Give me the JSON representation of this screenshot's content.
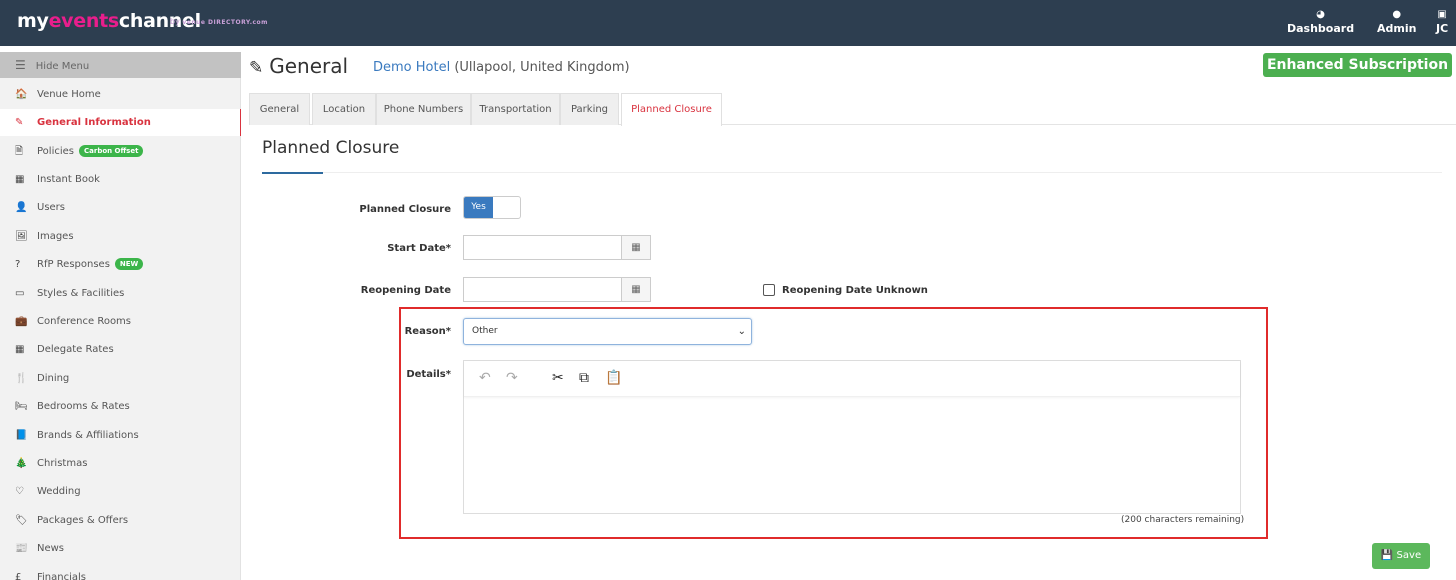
{
  "brand": {
    "part1": "my",
    "part2": "events",
    "part3": "channel",
    "by": "by",
    "by_brand": "venue DIRECTORY.com"
  },
  "topnav": [
    {
      "label": "Dashboard",
      "icon": "dashboard-icon"
    },
    {
      "label": "Admin",
      "icon": "user-circle-icon"
    },
    {
      "label": "JC",
      "icon": "id-badge-icon"
    }
  ],
  "sidebar": {
    "hide_menu": "Hide Menu",
    "items": [
      {
        "label": "Venue Home",
        "icon": "home-icon",
        "glyph": "🏠"
      },
      {
        "label": "General Information",
        "icon": "edit-icon",
        "glyph": "✎",
        "active": true
      },
      {
        "label": "Policies",
        "icon": "document-icon",
        "glyph": "🗎",
        "badge": "Carbon Offset"
      },
      {
        "label": "Instant Book",
        "icon": "calendar-icon",
        "glyph": "▦"
      },
      {
        "label": "Users",
        "icon": "user-icon",
        "glyph": "👤"
      },
      {
        "label": "Images",
        "icon": "image-icon",
        "glyph": "🖼"
      },
      {
        "label": "RfP Responses",
        "icon": "question-icon",
        "glyph": "?",
        "badge": "NEW"
      },
      {
        "label": "Styles & Facilities",
        "icon": "monitor-icon",
        "glyph": "▭"
      },
      {
        "label": "Conference Rooms",
        "icon": "briefcase-icon",
        "glyph": "💼"
      },
      {
        "label": "Delegate Rates",
        "icon": "calculator-icon",
        "glyph": "▦"
      },
      {
        "label": "Dining",
        "icon": "cutlery-icon",
        "glyph": "🍴"
      },
      {
        "label": "Bedrooms & Rates",
        "icon": "bed-icon",
        "glyph": "🛏"
      },
      {
        "label": "Brands & Affiliations",
        "icon": "book-icon",
        "glyph": "📘"
      },
      {
        "label": "Christmas",
        "icon": "tree-icon",
        "glyph": "🎄"
      },
      {
        "label": "Wedding",
        "icon": "heart-icon",
        "glyph": "♡"
      },
      {
        "label": "Packages & Offers",
        "icon": "tag-icon",
        "glyph": "🏷"
      },
      {
        "label": "News",
        "icon": "newspaper-icon",
        "glyph": "📰"
      },
      {
        "label": "Financials",
        "icon": "pound-icon",
        "glyph": "£"
      }
    ]
  },
  "header": {
    "title": "General",
    "venue_link": "Demo Hotel",
    "venue_location": "(Ullapool, United Kingdom)",
    "subscription": "Enhanced Subscription"
  },
  "tabs": [
    "General",
    "Location",
    "Phone Numbers",
    "Transportation",
    "Parking",
    "Planned Closure"
  ],
  "active_tab": "Planned Closure",
  "form": {
    "section_title": "Planned Closure",
    "planned_closure_label": "Planned Closure",
    "toggle_value": "Yes",
    "start_date_label": "Start Date*",
    "start_date_value": "",
    "reopening_date_label": "Reopening Date",
    "reopening_date_value": "",
    "reopening_unknown_label": "Reopening Date Unknown",
    "reason_label": "Reason*",
    "reason_value": "Other",
    "details_label": "Details*",
    "details_value": "",
    "chars_remaining": "(200 characters remaining)",
    "save_label": "Save"
  },
  "colors": {
    "topbar": "#2d3e50",
    "accent_red": "#d9333f",
    "link_blue": "#3a7abf",
    "green": "#4caf50",
    "highlight": "#e02b2b"
  }
}
